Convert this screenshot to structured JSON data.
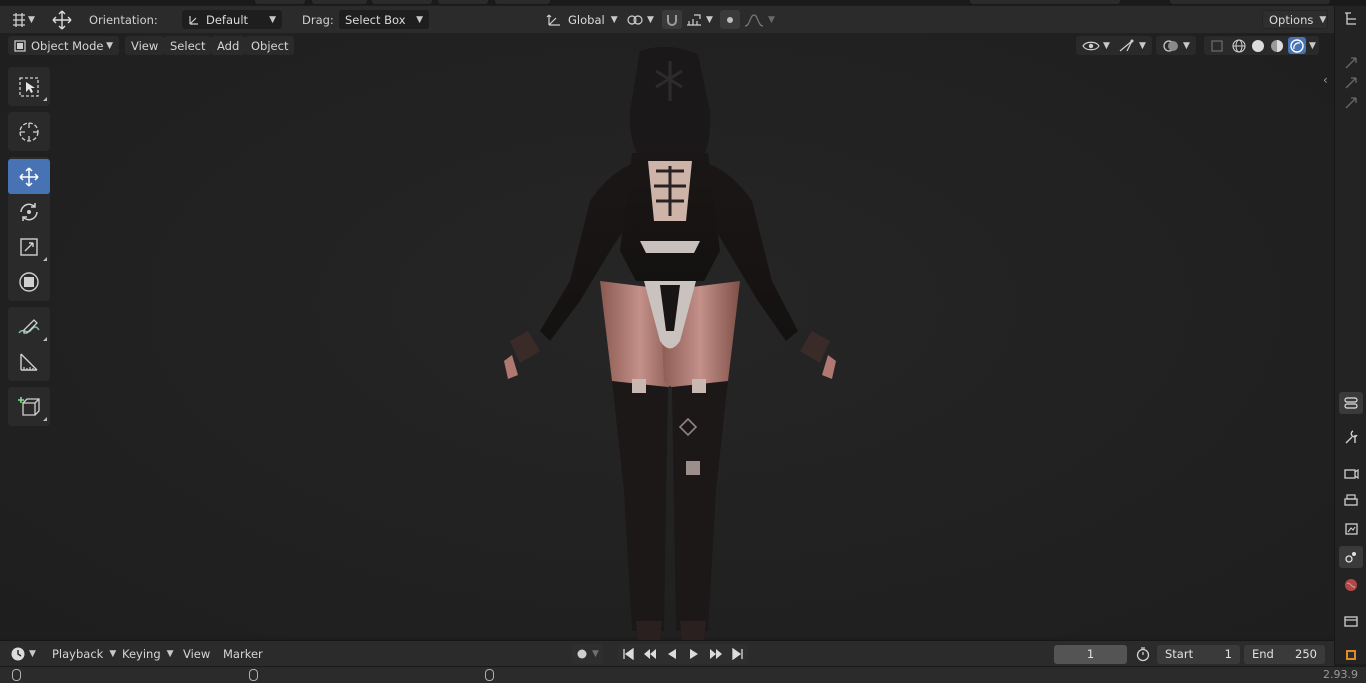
{
  "toolbar": {
    "orientation_label": "Orientation:",
    "orientation_value": "Default",
    "drag_label": "Drag:",
    "drag_value": "Select Box",
    "transform_orientation": "Global",
    "options_label": "Options"
  },
  "viewport_header": {
    "mode": "Object Mode",
    "menus": [
      "View",
      "Select",
      "Add",
      "Object"
    ]
  },
  "tools": [
    {
      "icon": "select-box-icon",
      "active": false
    },
    {
      "icon": "cursor-icon",
      "active": false
    },
    {
      "icon": "move-icon",
      "active": true
    },
    {
      "icon": "rotate-icon",
      "active": false
    },
    {
      "icon": "scale-icon",
      "active": false
    },
    {
      "icon": "transform-icon",
      "active": false
    },
    {
      "icon": "annotate-icon",
      "active": false
    },
    {
      "icon": "measure-icon",
      "active": false
    },
    {
      "icon": "add-cube-icon",
      "active": false
    }
  ],
  "timeline": {
    "playback": "Playback",
    "keying": "Keying",
    "view": "View",
    "marker": "Marker",
    "current_frame": "1",
    "start_label": "Start",
    "start_value": "1",
    "end_label": "End",
    "end_value": "250"
  },
  "status": {
    "version": "2.93.9"
  },
  "colors": {
    "accent": "#4772b3",
    "panel": "#2b2b2b",
    "viewport": "#222222"
  }
}
